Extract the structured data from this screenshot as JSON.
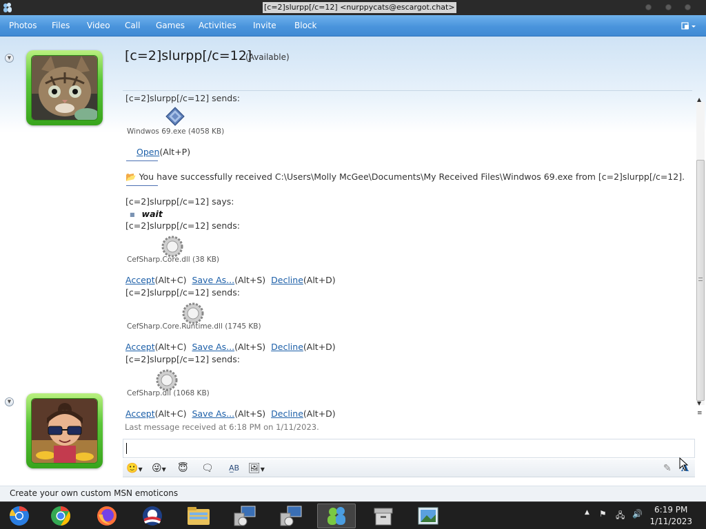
{
  "window": {
    "title": "[c=2]slurpp[/c=12] <nurppycats@escargot.chat>"
  },
  "menu": {
    "items": [
      "Photos",
      "Files",
      "Video",
      "Call",
      "Games",
      "Activities",
      "Invite",
      "Block"
    ]
  },
  "contact": {
    "name": "[c=2]slurpp[/c=12]",
    "status": "(Available)"
  },
  "conversation": {
    "sends_top": "[c=2]slurpp[/c=12] sends:",
    "file1": {
      "name": "Windwos 69.exe (4058 KB)"
    },
    "open_link": "Open",
    "open_hotkey": "(Alt+P)",
    "received_msg": "You have successfully received C:\\Users\\Molly McGee\\Documents\\My Received Files\\Windwos 69.exe from [c=2]slurpp[/c=12].",
    "says_header": "[c=2]slurpp[/c=12] says:",
    "says_text": "wait",
    "sends_header": "[c=2]slurpp[/c=12] sends:",
    "file2": {
      "name": "CefSharp.Core.dll (38 KB)"
    },
    "file3": {
      "name": "CefSharp.Core.Runtime.dll (1745 KB)"
    },
    "file4": {
      "name": "CefSharp.dll (1068 KB)"
    },
    "accept_label": "Accept",
    "accept_hotkey": "(Alt+C)",
    "saveas_label": "Save As...",
    "saveas_hotkey": "(Alt+S)",
    "decline_label": "Decline",
    "decline_hotkey": "(Alt+D)",
    "last_message": "Last message received at 6:18 PM on 1/11/2023."
  },
  "status_bar": {
    "text": "Create your own custom MSN emoticons"
  },
  "taskbar": {
    "apps": [
      "chromium-icon",
      "chrome-icon",
      "firefox-icon",
      "obama-logo-icon",
      "file-explorer-icon",
      "network-setup-icon",
      "network-setup-icon",
      "msn-messenger-icon",
      "archive-icon",
      "picture-viewer-icon"
    ],
    "time": "6:19 PM",
    "date": "1/11/2023"
  },
  "colors": {
    "menubar": "#4a94dc",
    "link": "#1c5fa8",
    "avatar_frame": "#5cc73a"
  }
}
